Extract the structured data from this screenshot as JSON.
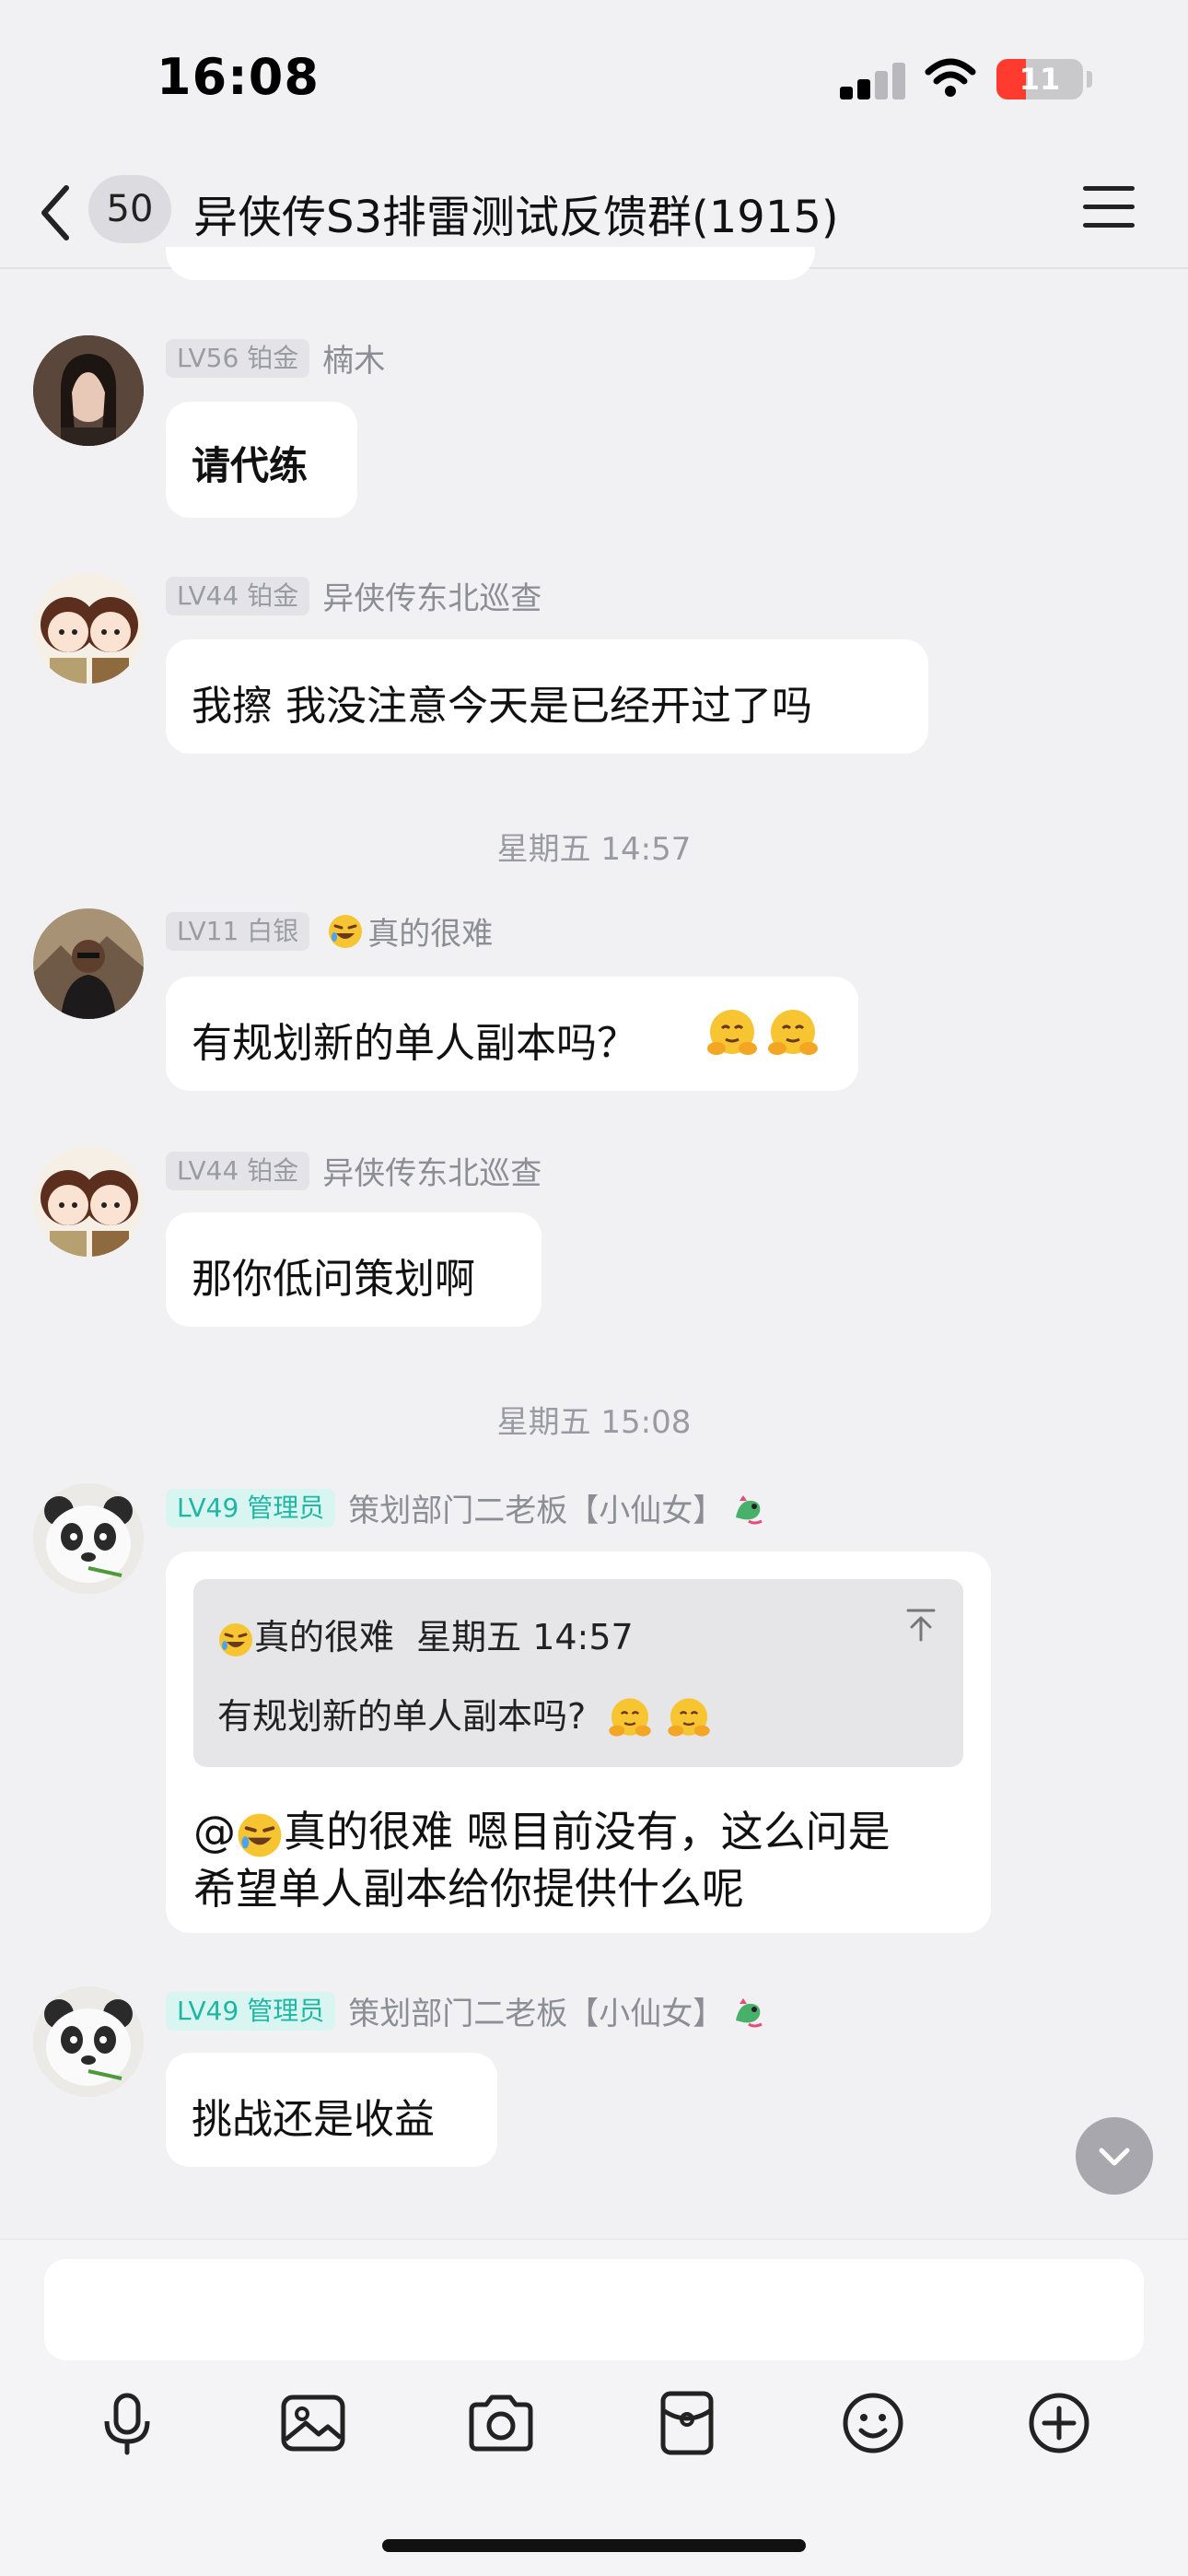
{
  "status_bar": {
    "time": "16:08",
    "battery": "11",
    "battery_level": 0.11,
    "battery_color": "#ff3b30"
  },
  "nav": {
    "unread": "50",
    "title": "异侠传S3排雷测试反馈群(1915)"
  },
  "colors": {
    "background": "#f1f1f3",
    "bubble": "#ffffff",
    "admin_badge_text": "#1fb7a3",
    "admin_badge_bg": "#d9f5f1"
  },
  "messages": [
    {
      "level": "LV56 铂金",
      "nick": "楠木",
      "text": "请代练",
      "avatar": "girl-photo"
    },
    {
      "level": "LV44 铂金",
      "nick": "异侠传东北巡查",
      "text": "我擦 我没注意今天是已经开过了吗",
      "avatar": "cartoon-couple"
    },
    {
      "level": "LV11 白银",
      "nick": "真的很难",
      "nick_emoji": "rofl-emoji",
      "text": "有规划新的单人副本吗？",
      "text_emojis": "hug-emoji",
      "avatar": "man-photo"
    },
    {
      "level": "LV44 铂金",
      "nick": "异侠传东北巡查",
      "text": "那你低问策划啊",
      "avatar": "cartoon-couple"
    },
    {
      "level": "LV49 管理员",
      "nick": "策划部门二老板【小仙女】",
      "nick_emoji": "dragon-emoji",
      "avatar": "panda",
      "quote": {
        "author": "真的很难",
        "time": "星期五 14:57",
        "text": "有规划新的单人副本吗?"
      },
      "reply_line1": "@",
      "reply_mention": "真的很难",
      "reply_rest1": " 嗯目前没有，这么问是",
      "reply_line2": "希望单人副本给你提供什么呢"
    },
    {
      "level": "LV49 管理员",
      "nick": "策划部门二老板【小仙女】",
      "nick_emoji": "dragon-emoji",
      "text": "挑战还是收益",
      "avatar": "panda"
    }
  ],
  "timestamps": [
    "星期五 14:57",
    "星期五 15:08"
  ],
  "toolbar": [
    "microphone-icon",
    "image-icon",
    "camera-icon",
    "red-packet-icon",
    "emoji-icon",
    "plus-icon"
  ]
}
